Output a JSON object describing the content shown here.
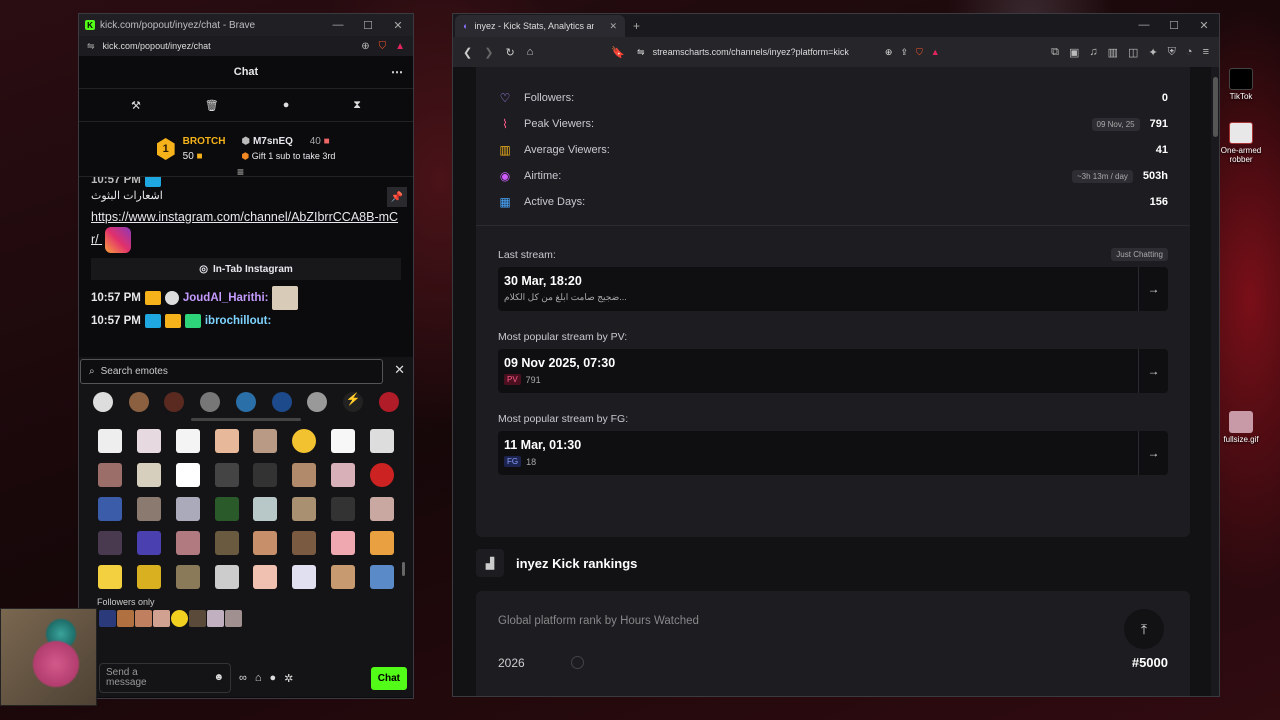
{
  "desktop": {
    "icons": [
      {
        "label": "TikTok"
      },
      {
        "label": "One-armed robber"
      },
      {
        "label": "fullsize.gif"
      }
    ]
  },
  "chat_window": {
    "title": "kick.com/popout/inyez/chat - Brave",
    "url": "kick.com/popout/inyez/chat",
    "header": "Chat",
    "gift": {
      "rank": "1",
      "leader_name": "BROTCH",
      "leader_count": "50",
      "second_name": "M7snEQ",
      "second_count": "40",
      "tip": "Gift 1 sub to take 3rd"
    },
    "messages": {
      "cut_top": "10:57 PM",
      "arabic_line": "اشعارات البثوث",
      "link": "https://www.instagram.com/channel/AbZIbrrCCA8B-mCr/",
      "intab_button": "In-Tab Instagram",
      "m1_time": "10:57 PM",
      "m1_user": "JoudAl_Harithi:",
      "m2_time": "10:57 PM",
      "m2_user": "ibrochillout:"
    },
    "emotes": {
      "search_placeholder": "Search emotes",
      "followers_only": "Followers only"
    },
    "input": {
      "placeholder": "Send a message",
      "chat_button": "Chat"
    }
  },
  "streams_window": {
    "tab_title": "inyez - Kick Stats, Analytics and",
    "url": "streamscharts.com/channels/inyez?platform=kick",
    "stats": [
      {
        "label": "Followers:",
        "value": "0",
        "pill": ""
      },
      {
        "label": "Peak Viewers:",
        "value": "791",
        "pill": "09 Nov, 25"
      },
      {
        "label": "Average Viewers:",
        "value": "41",
        "pill": ""
      },
      {
        "label": "Airtime:",
        "value": "503h",
        "pill": "~3h 13m / day"
      },
      {
        "label": "Active Days:",
        "value": "156",
        "pill": ""
      }
    ],
    "last_stream": {
      "label": "Last stream:",
      "category": "Just Chatting",
      "date": "30 Mar, 18:20",
      "title": "ضجيج صامت ابلغ من كل الكلام..."
    },
    "popular_pv": {
      "label": "Most popular stream by PV:",
      "date": "09 Nov 2025, 07:30",
      "tag": "PV",
      "value": "791"
    },
    "popular_fg": {
      "label": "Most popular stream by FG:",
      "date": "11 Mar, 01:30",
      "tag": "FG",
      "value": "18"
    },
    "rankings": {
      "heading": "inyez Kick rankings",
      "subtitle": "Global platform rank by Hours Watched",
      "year": "2026",
      "rank": "#5000"
    }
  }
}
